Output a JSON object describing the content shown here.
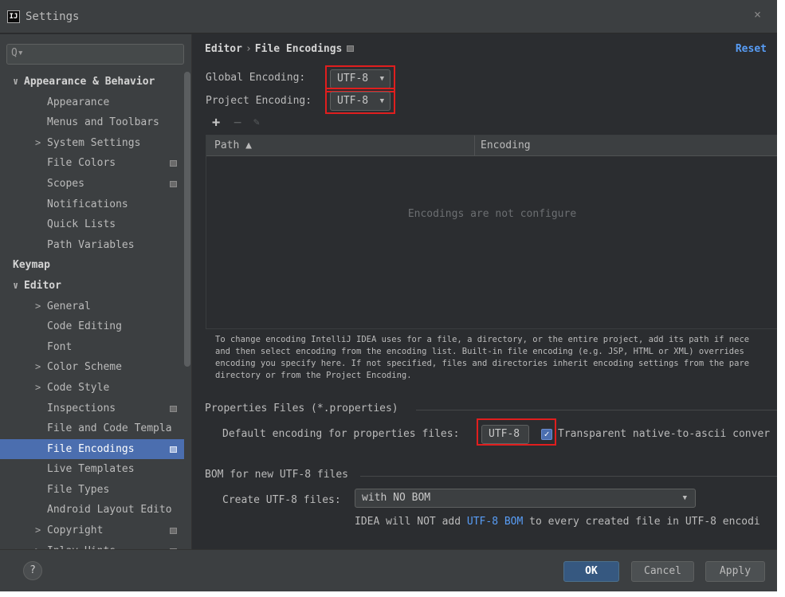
{
  "window": {
    "title": "Settings",
    "app_icon_text": "IJ",
    "close": "×"
  },
  "search": {
    "value": "",
    "placeholder": "Q▾"
  },
  "sidebar": {
    "items": [
      {
        "label": "Appearance & Behavior",
        "chevron": "∨",
        "bold": true
      },
      {
        "label": "Appearance"
      },
      {
        "label": "Menus and Toolbars"
      },
      {
        "label": "System Settings",
        "chevron": ">"
      },
      {
        "label": "File Colors",
        "project_icon": true
      },
      {
        "label": "Scopes",
        "project_icon": true
      },
      {
        "label": "Notifications"
      },
      {
        "label": "Quick Lists"
      },
      {
        "label": "Path Variables"
      },
      {
        "label": "Keymap",
        "bold": true
      },
      {
        "label": "Editor",
        "chevron": "∨",
        "bold": true
      },
      {
        "label": "General",
        "chevron": ">"
      },
      {
        "label": "Code Editing"
      },
      {
        "label": "Font"
      },
      {
        "label": "Color Scheme",
        "chevron": ">"
      },
      {
        "label": "Code Style",
        "chevron": ">"
      },
      {
        "label": "Inspections",
        "project_icon": true
      },
      {
        "label": "File and Code Templa"
      },
      {
        "label": "File Encodings",
        "project_icon": true,
        "selected": true
      },
      {
        "label": "Live Templates"
      },
      {
        "label": "File Types"
      },
      {
        "label": "Android Layout Edito"
      },
      {
        "label": "Copyright",
        "chevron": ">",
        "project_icon": true
      },
      {
        "label": "Inlay Hints",
        "chevron": ">",
        "project_icon": true
      }
    ]
  },
  "breadcrumb": {
    "parent": "Editor",
    "separator": "›",
    "current": "File Encodings"
  },
  "reset_label": "Reset",
  "global_encoding": {
    "label": "Global Encoding:",
    "value": "UTF-8"
  },
  "project_encoding": {
    "label": "Project Encoding:",
    "value": "UTF-8"
  },
  "toolbar": {
    "add": "+",
    "remove": "−",
    "edit": "✎"
  },
  "table": {
    "columns": [
      "Path ▲",
      "Encoding"
    ],
    "empty_text": "Encodings are not configure"
  },
  "help_text": [
    "To change encoding IntelliJ IDEA uses for a file, a directory, or the entire project, add its path if nece",
    "and then select encoding from the encoding list. Built-in file encoding (e.g. JSP, HTML or XML) overrides",
    "encoding you specify here. If not specified, files and directories inherit encoding settings from the pare",
    "directory or from the Project Encoding."
  ],
  "properties": {
    "section_title": "Properties Files (*.properties)",
    "label": "Default encoding for properties files:",
    "value": "UTF-8",
    "checkbox_checked": true,
    "checkbox_label": "Transparent native-to-ascii conver"
  },
  "bom": {
    "section_title": "BOM for new UTF-8 files",
    "label": "Create UTF-8 files:",
    "value": "with NO BOM",
    "note_prefix": "IDEA will NOT add ",
    "note_link": "UTF-8 BOM",
    "note_suffix": " to every created file in UTF-8 encodi"
  },
  "footer": {
    "help": "?",
    "ok": "OK",
    "cancel": "Cancel",
    "apply": "Apply"
  },
  "colors": {
    "accent": "#4b6eaf",
    "link": "#589df6",
    "highlight_border": "#e01e1e",
    "background": "#2b2d30"
  }
}
